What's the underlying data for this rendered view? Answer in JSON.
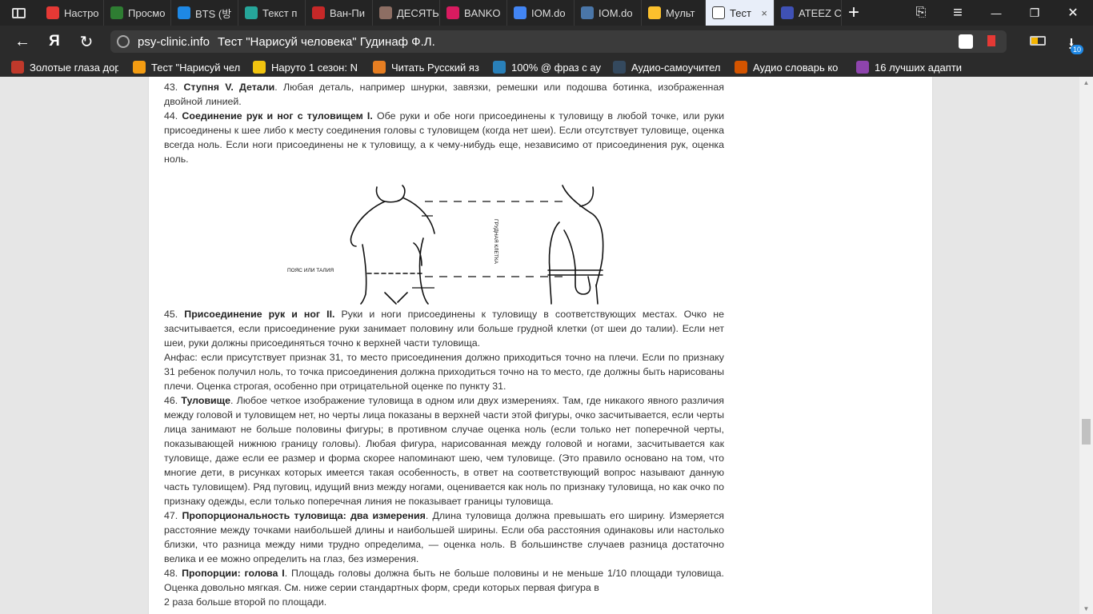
{
  "tabs": [
    {
      "label": "Настро",
      "icon": "yandex-icon",
      "color": "#e53935"
    },
    {
      "label": "Просмо",
      "icon": "fs-icon",
      "color": "#2e7d32"
    },
    {
      "label": "BTS (방",
      "icon": "music-icon",
      "color": "#1e88e5"
    },
    {
      "label": "Текст п",
      "icon": "doc-icon",
      "color": "#26a69a"
    },
    {
      "label": "Ван-Пи",
      "icon": "onepiece-icon",
      "color": "#c62828"
    },
    {
      "label": "ДЕСЯТЬ",
      "icon": "pause-icon",
      "color": "#8d6e63"
    },
    {
      "label": "BANKO",
      "icon": "instagram-icon",
      "color": "#d81b60"
    },
    {
      "label": "IOM.do",
      "icon": "docs-icon",
      "color": "#4285f4"
    },
    {
      "label": "IOM.do",
      "icon": "vk-icon",
      "color": "#4a76a8"
    },
    {
      "label": "Мульт",
      "icon": "cartoon-icon",
      "color": "#fbc02d"
    },
    {
      "label": "Тест",
      "icon": "page-icon",
      "color": "#ffffff",
      "active": true
    },
    {
      "label": "ATEEZ C",
      "icon": "pause-icon",
      "color": "#3f51b5"
    }
  ],
  "tab_close": "×",
  "new_tab": "+",
  "window": {
    "minimize": "—",
    "maximize": "❐",
    "close": "✕",
    "menu": "≡",
    "bookmarks_icon": "⎘"
  },
  "address": {
    "back": "←",
    "yandex": "Я",
    "reload": "↻",
    "site": "psy-clinic.info",
    "title": "Тест \"Нарисуй человека\" Гудинаф Ф.Л.",
    "downloads_count": "10"
  },
  "bookmarks": [
    {
      "label": "Золотые глаза дор",
      "color": "#c0392b"
    },
    {
      "label": "Тест \"Нарисуй чел",
      "color": "#f39c12"
    },
    {
      "label": "Наруто 1 сезон: N",
      "color": "#f1c40f"
    },
    {
      "label": "Читать Русский яз",
      "color": "#e67e22"
    },
    {
      "label": "100% @ фраз с ау",
      "color": "#2980b9"
    },
    {
      "label": "Аудио-самоучител",
      "color": "#34495e"
    },
    {
      "label": "Аудио словарь ко",
      "color": "#d35400"
    },
    {
      "label": "16 лучших адапти",
      "color": "#8e44ad"
    }
  ],
  "article": {
    "item43": {
      "num": "43.",
      "title": "Ступня V. Детали",
      "text": ". Любая деталь, например шнурки, завязки, ремешки или подошва ботинка, изображенная двойной линией."
    },
    "item44": {
      "num": "44.",
      "title": "Соединение рук и ног с туловищем I.",
      "text": " Обе руки и обе ноги присоединены к туловищу в любой точке, или руки присоединены к шее либо к месту соединения головы с туловищем (когда нет шеи). Если отсутствует туловище, оценка всегда ноль. Если ноги присоединены не к туловищу, а к чему-нибудь еще, независимо от присоединения рук, оценка ноль."
    },
    "figure": {
      "waist_label": "ПОЯС ИЛИ ТАЛИЯ",
      "vertical_label": "ГРУДНАЯ КЛЕТКА"
    },
    "item45": {
      "num": "45.",
      "title": "Присоединение рук и ног II.",
      "text": " Руки и ноги присоединены к туловищу в соответствующих местах. Очко не засчитывается, если присоединение руки занимает половину или больше грудной клетки (от шеи до талии). Если нет шеи, руки должны присоединяться точно к верхней части туловища."
    },
    "item45b": "Анфас: если присутствует признак 31, то место присоединения должно приходиться точно на плечи. Если по признаку 31 ребенок получил ноль, то точка присоединения должна приходиться точно на то место, где должны быть нарисованы плечи. Оценка строгая, особенно при отрицательной оценке по пункту 31.",
    "item46": {
      "num": "46.",
      "title": "Туловище",
      "text": ". Любое четкое изображение туловища в одном или двух измерениях. Там, где никакого явного различия между головой и туловищем нет, но черты лица показаны в верхней части этой фигуры, очко засчитывается, если черты лица занимают не больше половины фигуры; в противном случае оценка ноль (если только нет поперечной черты, показывающей нижнюю границу головы). Любая фигура, нарисованная между головой и ногами, засчитывается как туловище, даже если ее размер и форма скорее напоминают шею, чем туловище. (Это правило основано на том, что многие дети, в рисунках которых имеется такая особенность, в ответ на соответствующий вопрос называют данную часть туловищем). Ряд пуговиц, идущий вниз между ногами, оценивается как ноль по признаку туловища, но как очко по признаку одежды, если только поперечная линия не показывает границы туловища."
    },
    "item47": {
      "num": "47.",
      "title": "Пропорциональность туловища: два измерения",
      "text": ". Длина туловища должна превышать его ширину. Измеряется расстояние между точками наибольшей длины и наибольшей ширины. Если оба расстояния одинаковы или настолько близки, что разница между ними трудно определима, — оценка ноль. В большинстве случаев разница достаточно велика и ее можно определить на глаз, без измерения."
    },
    "item48": {
      "num": "48.",
      "title": "Пропорции: голова I",
      "text": ". Площадь головы должна быть не больше половины и не меньше 1/10 площади туловища. Оценка довольно мягкая. См. ниже серии стандартных форм, среди которых первая фигура в"
    },
    "item48b": "2 раза больше второй по площади."
  }
}
